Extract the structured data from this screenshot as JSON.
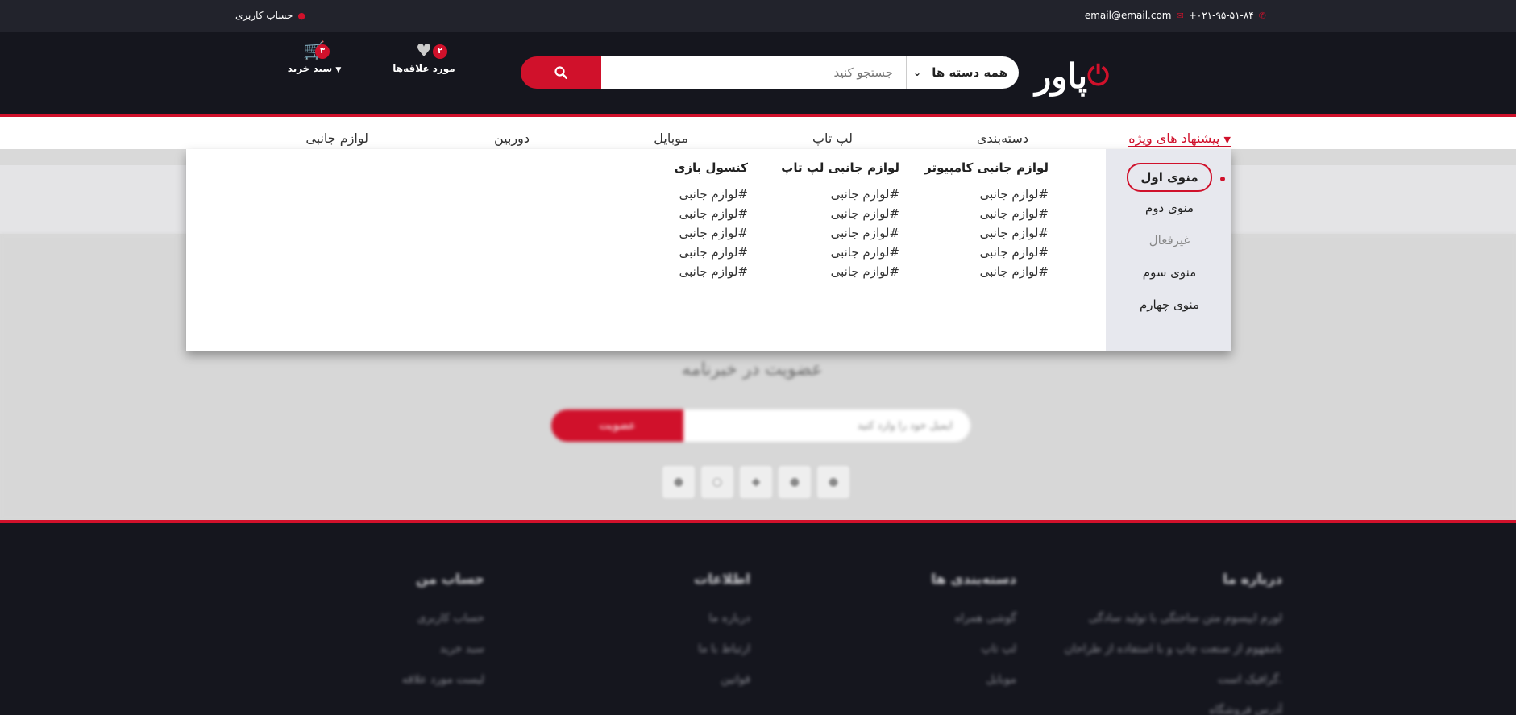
{
  "colors": {
    "accent": "#d0112b",
    "topbar": "#22232c",
    "header": "#15161e"
  },
  "topbar": {
    "phone": "+۰۲۱-۹۵-۵۱-۸۴",
    "email": "email@email.com",
    "account": "حساب کاربری",
    "icons": {
      "phone": "phone-icon",
      "email": "envelope-icon",
      "account": "user-icon"
    }
  },
  "header": {
    "logo": "پاور",
    "search": {
      "placeholder": "جستجو کنید",
      "category": "همه دسته ها"
    },
    "wishlist": {
      "label": "مورد علاقه‌ها",
      "count": "۲"
    },
    "cart": {
      "label": "سبد خرید",
      "count": "۳"
    }
  },
  "nav": {
    "items": [
      {
        "label": "پیشنهاد های ویژه"
      },
      {
        "label": "دسته‌بندی"
      },
      {
        "label": "لپ تاپ"
      },
      {
        "label": "موبایل"
      },
      {
        "label": "دوربین"
      },
      {
        "label": "لوازم جانبی"
      }
    ]
  },
  "mega_menu": {
    "side": [
      "منوی اول",
      "منوی دوم",
      "غیرفعال",
      "منوی سوم",
      "منوی چهارم"
    ],
    "columns": [
      {
        "title": "لوازم جانبی کامپیوتر",
        "links": [
          "#لوازم جانبی",
          "#لوازم جانبی",
          "#لوازم جانبی",
          "#لوازم جانبی",
          "#لوازم جانبی"
        ]
      },
      {
        "title": "لوازم جانبی لپ تاپ",
        "links": [
          "#لوازم جانبی",
          "#لوازم جانبی",
          "#لوازم جانبی",
          "#لوازم جانبی",
          "#لوازم جانبی"
        ]
      },
      {
        "title": "کنسول بازی",
        "links": [
          "#لوازم جانبی",
          "#لوازم جانبی",
          "#لوازم جانبی",
          "#لوازم جانبی",
          "#لوازم جانبی"
        ]
      }
    ]
  },
  "newsletter": {
    "title": "عضویت در خبرنامه",
    "placeholder": "ایمیل خود را وارد کنید",
    "button": "عضویت"
  },
  "footer": {
    "columns": [
      {
        "title": "درباره ما",
        "lines": [
          "لورم ایپسوم متن ساختگی با تولید سادگی",
          "نامفهوم از صنعت چاپ و با استفاده از طراحان",
          "گرافیک است.",
          "آدرس فروشگاه"
        ]
      },
      {
        "title": "دسته‌بندی ها",
        "lines": [
          "گوشی همراه",
          "لپ تاپ",
          "موبایل"
        ]
      },
      {
        "title": "اطلاعات",
        "lines": [
          "درباره ما",
          "ارتباط با ما",
          "قوانین"
        ]
      },
      {
        "title": "حساب من",
        "lines": [
          "حساب کاربری",
          "سبد خرید",
          "لیست مورد علاقه"
        ]
      }
    ]
  }
}
